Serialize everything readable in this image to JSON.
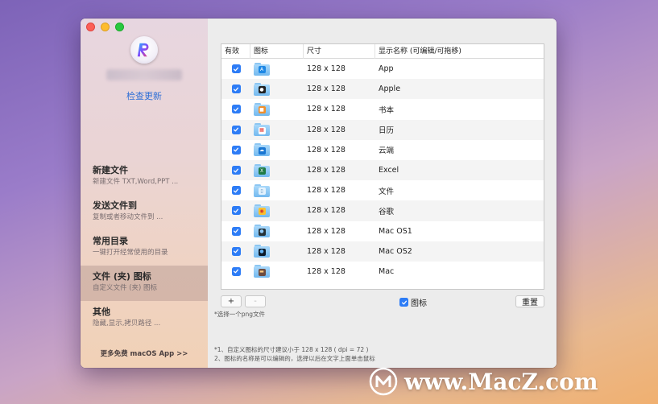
{
  "sidebar": {
    "update_link": "检查更新",
    "items": [
      {
        "title": "新建文件",
        "subtitle": "新建文件 TXT,Word,PPT ..."
      },
      {
        "title": "发送文件到",
        "subtitle": "复制或者移动文件到 ..."
      },
      {
        "title": "常用目录",
        "subtitle": "一键打开经常使用的目录"
      },
      {
        "title": "文件 (夹) 图标",
        "subtitle": "自定义文件 (夹) 图标"
      },
      {
        "title": "其他",
        "subtitle": "隐藏,显示,拷贝路径 ..."
      }
    ],
    "more_apps": "更多免费 macOS App >>"
  },
  "table": {
    "headers": {
      "valid": "有效",
      "icon": "图标",
      "size": "尺寸",
      "name": "显示名称 (可编辑/可拖移)"
    },
    "rows": [
      {
        "size": "128 x 128",
        "name": "App",
        "icon": "app-store-icon"
      },
      {
        "size": "128 x 128",
        "name": "Apple",
        "icon": "apple-icon"
      },
      {
        "size": "128 x 128",
        "name": "书本",
        "icon": "book-icon"
      },
      {
        "size": "128 x 128",
        "name": "日历",
        "icon": "calendar-icon"
      },
      {
        "size": "128 x 128",
        "name": "云端",
        "icon": "cloud-icon"
      },
      {
        "size": "128 x 128",
        "name": "Excel",
        "icon": "excel-icon"
      },
      {
        "size": "128 x 128",
        "name": "文件",
        "icon": "document-icon"
      },
      {
        "size": "128 x 128",
        "name": "谷歌",
        "icon": "chrome-icon"
      },
      {
        "size": "128 x 128",
        "name": "Mac OS1",
        "icon": "macos-icon"
      },
      {
        "size": "128 x 128",
        "name": "Mac OS2",
        "icon": "macos-dark-icon"
      },
      {
        "size": "128 x 128",
        "name": "Mac",
        "icon": "mac-icon"
      }
    ]
  },
  "controls": {
    "add_label": "+",
    "remove_label": "-",
    "icon_toggle_label": "图标",
    "reset_label": "重置",
    "hint": "*选择一个png文件"
  },
  "notes": [
    "*1、自定义图标的尺寸建议小于 128 x 128 ( dpi = 72 )",
    "  2、图标的名称是可以编辑的，选择以后在文字上面单击鼠标"
  ],
  "watermark": "www.MacZ.com",
  "colors": {
    "accent": "#2d7cf6",
    "link": "#2f6fd6",
    "folder": "#73b9ef"
  }
}
